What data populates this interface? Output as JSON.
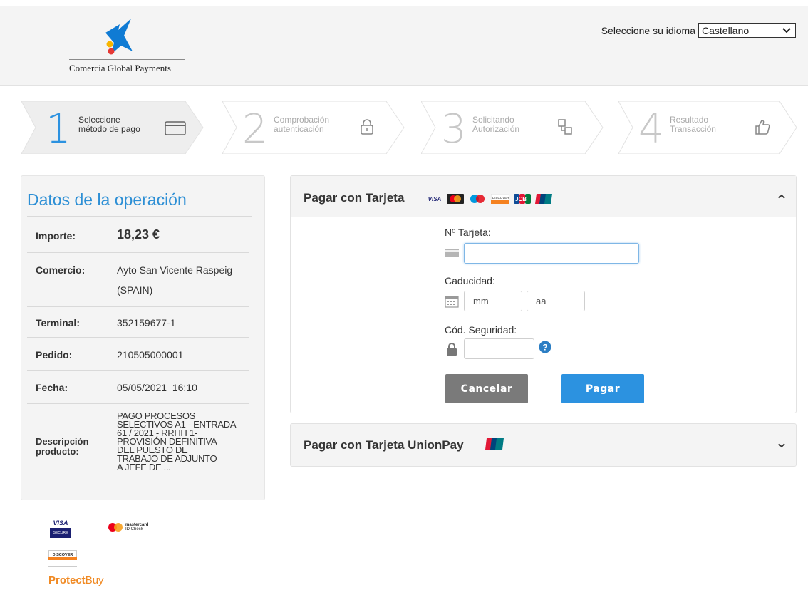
{
  "header": {
    "logo_text": "Comercia Global Payments",
    "language_label": "Seleccione su idioma",
    "language_selected": "Castellano"
  },
  "steps": [
    {
      "number": "1",
      "line1": "Seleccione",
      "line2": "método de pago",
      "icon": "credit-card-icon",
      "active": true
    },
    {
      "number": "2",
      "line1": "Comprobación",
      "line2": "autenticación",
      "icon": "lock-icon",
      "active": false
    },
    {
      "number": "3",
      "line1": "Solicitando",
      "line2": "Autorización",
      "icon": "transfer-icon",
      "active": false
    },
    {
      "number": "4",
      "line1": "Resultado",
      "line2": "Transacción",
      "icon": "thumbs-up-icon",
      "active": false
    }
  ],
  "operation": {
    "title": "Datos de la operación",
    "importe_label": "Importe:",
    "importe_value": "18,23 €",
    "comercio_label": "Comercio:",
    "comercio_value_1": "Ayto San Vicente Raspeig",
    "comercio_value_2": "(SPAIN)",
    "terminal_label": "Terminal:",
    "terminal_value": "352159677-1",
    "pedido_label": "Pedido:",
    "pedido_value": "210505000001",
    "fecha_label": "Fecha:",
    "fecha_value": "05/05/2021  16:10",
    "descripcion_label_1": "Descripción",
    "descripcion_label_2": "producto:",
    "descripcion_lines": [
      "PAGO PROCESOS",
      "SELECTIVOS A1 - Entrada",
      "61 / 2021 - RRHH 1-",
      "PROVISIÓN DEFINITIVA",
      "DEL PUESTO DE",
      "TRABAJO DE ADJUNTO",
      "A JEFE DE ..."
    ]
  },
  "card_payment": {
    "title": "Pagar con Tarjeta",
    "brands": [
      "VISA",
      "mastercard",
      "maestro",
      "DISCOVER",
      "JCB",
      "UnionPay"
    ],
    "card_number_label": "Nº Tarjeta:",
    "card_number_value": "",
    "expiry_label": "Caducidad:",
    "expiry_month_placeholder": "mm",
    "expiry_year_placeholder": "aa",
    "cvv_label": "Cód. Seguridad:",
    "cvv_value": "",
    "cancel_label": "Cancelar",
    "pay_label": "Pagar"
  },
  "unionpay_payment": {
    "title": "Pagar con Tarjeta UnionPay"
  },
  "footer_logos": {
    "visa_secure_1": "VISA",
    "visa_secure_2": "SECURE",
    "mastercard_1": "mastercard",
    "mastercard_2": "ID Check",
    "discover": "DISCOVER",
    "protectbuy_1": "Protect",
    "protectbuy_2": "Buy"
  },
  "colors": {
    "accent_blue": "#2c92e0",
    "cancel_gray": "#7a7a7a",
    "panel_bg": "#f4f4f4"
  }
}
